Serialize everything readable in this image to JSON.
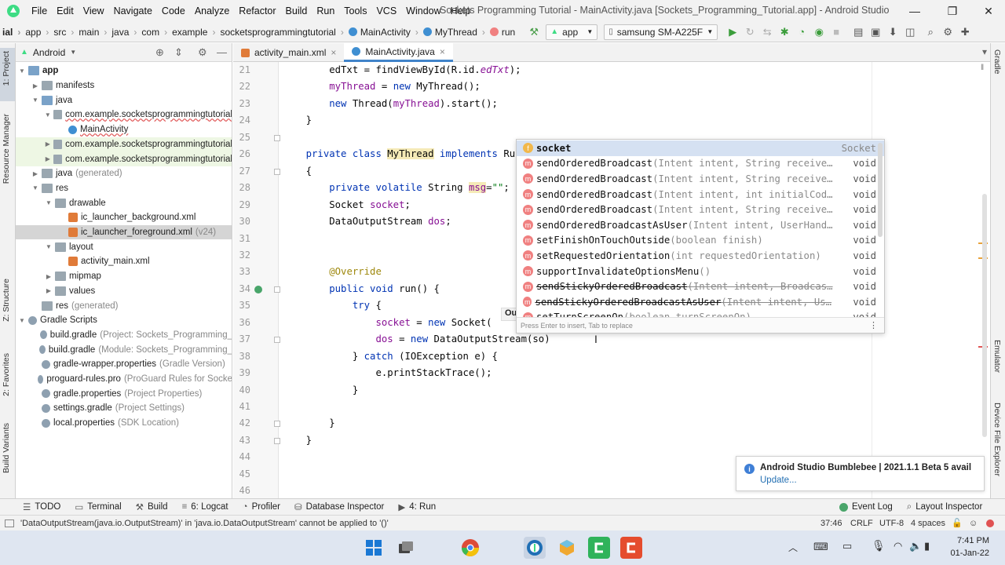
{
  "menubar": {
    "items": [
      "File",
      "Edit",
      "View",
      "Navigate",
      "Code",
      "Analyze",
      "Refactor",
      "Build",
      "Run",
      "Tools",
      "VCS",
      "Window",
      "Help"
    ],
    "title": "Sockets Programming Tutorial - MainActivity.java [Sockets_Programming_Tutorial.app] - Android Studio"
  },
  "breadcrumb": [
    "ial",
    "app",
    "src",
    "main",
    "java",
    "com",
    "example",
    "socketsprogrammingtutorial",
    "MainActivity",
    "MyThread",
    "run"
  ],
  "toolbar": {
    "run_config": "app",
    "device": "samsung SM-A225F"
  },
  "left_strip": {
    "project": "1: Project",
    "resource_manager": "Resource Manager",
    "structure": "Z: Structure",
    "favorites": "2: Favorites",
    "build_variants": "Build Variants"
  },
  "project_panel": {
    "view_mode": "Android",
    "tree": [
      {
        "label": "app",
        "extra": "",
        "depth": 0,
        "arrow": "down",
        "icon": "folder-blue",
        "bold": true
      },
      {
        "label": "manifests",
        "extra": "",
        "depth": 1,
        "arrow": "right",
        "icon": "folder"
      },
      {
        "label": "java",
        "extra": "",
        "depth": 1,
        "arrow": "down",
        "icon": "folder-blue"
      },
      {
        "label": "com.example.socketsprogrammingtutorial",
        "extra": "",
        "depth": 2,
        "arrow": "down",
        "icon": "folder",
        "squiggle": true
      },
      {
        "label": "MainActivity",
        "extra": "",
        "depth": 3,
        "arrow": "",
        "icon": "class",
        "squiggle": true
      },
      {
        "label": "com.example.socketsprogrammingtutorial",
        "extra": "",
        "depth": 2,
        "arrow": "right",
        "icon": "folder",
        "hl": "green"
      },
      {
        "label": "com.example.socketsprogrammingtutorial",
        "extra": "",
        "depth": 2,
        "arrow": "right",
        "icon": "folder",
        "hl": "green"
      },
      {
        "label": "java",
        "extra": "(generated)",
        "depth": 1,
        "arrow": "right",
        "icon": "folder"
      },
      {
        "label": "res",
        "extra": "",
        "depth": 1,
        "arrow": "down",
        "icon": "folder"
      },
      {
        "label": "drawable",
        "extra": "",
        "depth": 2,
        "arrow": "down",
        "icon": "folder"
      },
      {
        "label": "ic_launcher_background.xml",
        "extra": "",
        "depth": 3,
        "arrow": "",
        "icon": "xml"
      },
      {
        "label": "ic_launcher_foreground.xml",
        "extra": "(v24)",
        "depth": 3,
        "arrow": "",
        "icon": "xml",
        "hl": "gray"
      },
      {
        "label": "layout",
        "extra": "",
        "depth": 2,
        "arrow": "down",
        "icon": "folder"
      },
      {
        "label": "activity_main.xml",
        "extra": "",
        "depth": 3,
        "arrow": "",
        "icon": "xml"
      },
      {
        "label": "mipmap",
        "extra": "",
        "depth": 2,
        "arrow": "right",
        "icon": "folder"
      },
      {
        "label": "values",
        "extra": "",
        "depth": 2,
        "arrow": "right",
        "icon": "folder"
      },
      {
        "label": "res",
        "extra": "(generated)",
        "depth": 1,
        "arrow": "",
        "icon": "folder"
      },
      {
        "label": "Gradle Scripts",
        "extra": "",
        "depth": 0,
        "arrow": "down",
        "icon": "gradle"
      },
      {
        "label": "build.gradle",
        "extra": "(Project: Sockets_Programming_",
        "depth": 1,
        "arrow": "",
        "icon": "gradle"
      },
      {
        "label": "build.gradle",
        "extra": "(Module: Sockets_Programming_",
        "depth": 1,
        "arrow": "",
        "icon": "gradle"
      },
      {
        "label": "gradle-wrapper.properties",
        "extra": "(Gradle Version)",
        "depth": 1,
        "arrow": "",
        "icon": "gradle"
      },
      {
        "label": "proguard-rules.pro",
        "extra": "(ProGuard Rules for Socke",
        "depth": 1,
        "arrow": "",
        "icon": "gradle"
      },
      {
        "label": "gradle.properties",
        "extra": "(Project Properties)",
        "depth": 1,
        "arrow": "",
        "icon": "gradle"
      },
      {
        "label": "settings.gradle",
        "extra": "(Project Settings)",
        "depth": 1,
        "arrow": "",
        "icon": "gradle"
      },
      {
        "label": "local.properties",
        "extra": "(SDK Location)",
        "depth": 1,
        "arrow": "",
        "icon": "gradle"
      }
    ]
  },
  "editor": {
    "tabs": [
      {
        "label": "activity_main.xml",
        "active": false
      },
      {
        "label": "MainActivity.java",
        "active": true
      }
    ],
    "line_numbers": [
      "21",
      "22",
      "23",
      "24",
      "25",
      "26",
      "27",
      "28",
      "29",
      "30",
      "31",
      "32",
      "33",
      "34",
      "35",
      "36",
      "37",
      "38",
      "39",
      "40",
      "41",
      "42",
      "43",
      "44",
      "45",
      "46"
    ],
    "lines": [
      [
        {
          "t": "        edTxt = findViewById(R.id.",
          "c": ""
        },
        {
          "t": "edTxt",
          "c": "it"
        },
        {
          "t": ");",
          "c": ""
        }
      ],
      [
        {
          "t": "        ",
          "c": ""
        },
        {
          "t": "myThread",
          "c": "fld"
        },
        {
          "t": " = ",
          "c": ""
        },
        {
          "t": "new",
          "c": "kw"
        },
        {
          "t": " MyThread();",
          "c": ""
        }
      ],
      [
        {
          "t": "        ",
          "c": ""
        },
        {
          "t": "new",
          "c": "kw"
        },
        {
          "t": " Thread(",
          "c": ""
        },
        {
          "t": "myThread",
          "c": "fld"
        },
        {
          "t": ").start();",
          "c": ""
        }
      ],
      [
        {
          "t": "    }",
          "c": ""
        }
      ],
      [
        {
          "t": "",
          "c": ""
        }
      ],
      [
        {
          "t": "    ",
          "c": ""
        },
        {
          "t": "private class",
          "c": "kw"
        },
        {
          "t": " ",
          "c": ""
        },
        {
          "t": "MyThread",
          "c": "hl"
        },
        {
          "t": " ",
          "c": ""
        },
        {
          "t": "implements",
          "c": "kw"
        },
        {
          "t": " Ru",
          "c": ""
        }
      ],
      [
        {
          "t": "    {",
          "c": ""
        }
      ],
      [
        {
          "t": "        ",
          "c": ""
        },
        {
          "t": "private volatile",
          "c": "kw"
        },
        {
          "t": " String ",
          "c": ""
        },
        {
          "t": "msg",
          "c": "fld hl"
        },
        {
          "t": "=",
          "c": ""
        },
        {
          "t": "\"\"",
          "c": "str"
        },
        {
          "t": ";",
          "c": ""
        }
      ],
      [
        {
          "t": "        Socket ",
          "c": ""
        },
        {
          "t": "socket",
          "c": "fld"
        },
        {
          "t": ";",
          "c": ""
        }
      ],
      [
        {
          "t": "        DataOutputStream ",
          "c": ""
        },
        {
          "t": "dos",
          "c": "fld"
        },
        {
          "t": ";",
          "c": ""
        }
      ],
      [
        {
          "t": "",
          "c": ""
        }
      ],
      [
        {
          "t": "",
          "c": ""
        }
      ],
      [
        {
          "t": "        ",
          "c": ""
        },
        {
          "t": "@Override",
          "c": "ann"
        }
      ],
      [
        {
          "t": "        ",
          "c": ""
        },
        {
          "t": "public void",
          "c": "kw"
        },
        {
          "t": " run() {",
          "c": ""
        }
      ],
      [
        {
          "t": "            ",
          "c": ""
        },
        {
          "t": "try",
          "c": "kw"
        },
        {
          "t": " {",
          "c": ""
        }
      ],
      [
        {
          "t": "                ",
          "c": ""
        },
        {
          "t": "socket",
          "c": "fld"
        },
        {
          "t": " = ",
          "c": ""
        },
        {
          "t": "new",
          "c": "kw"
        },
        {
          "t": " Socket(",
          "c": ""
        }
      ],
      [
        {
          "t": "                ",
          "c": ""
        },
        {
          "t": "dos",
          "c": "fld"
        },
        {
          "t": " = ",
          "c": ""
        },
        {
          "t": "new",
          "c": "kw"
        },
        {
          "t": " DataOutputStream(so)",
          "c": ""
        }
      ],
      [
        {
          "t": "            } ",
          "c": ""
        },
        {
          "t": "catch",
          "c": "kw"
        },
        {
          "t": " (IOException e) {",
          "c": ""
        }
      ],
      [
        {
          "t": "                e.printStackTrace();",
          "c": ""
        }
      ],
      [
        {
          "t": "            }",
          "c": ""
        }
      ],
      [
        {
          "t": "",
          "c": ""
        }
      ],
      [
        {
          "t": "        }",
          "c": ""
        }
      ],
      [
        {
          "t": "    }",
          "c": ""
        }
      ],
      [
        {
          "t": "",
          "c": ""
        }
      ],
      [
        {
          "t": "",
          "c": ""
        }
      ],
      [
        {
          "t": "",
          "c": ""
        }
      ]
    ],
    "param_hint": "Ou"
  },
  "completion": {
    "items": [
      {
        "badge": "f",
        "name": "socket",
        "params": "",
        "ret": "Socket",
        "selected": true,
        "strike": false
      },
      {
        "badge": "m",
        "name": "sendOrderedBroadcast",
        "params": "(Intent intent, String receive…",
        "ret": "void",
        "strike": false
      },
      {
        "badge": "m",
        "name": "sendOrderedBroadcast",
        "params": "(Intent intent, String receive…",
        "ret": "void",
        "strike": false
      },
      {
        "badge": "m",
        "name": "sendOrderedBroadcast",
        "params": "(Intent intent, int initialCod…",
        "ret": "void",
        "strike": false
      },
      {
        "badge": "m",
        "name": "sendOrderedBroadcast",
        "params": "(Intent intent, String receive…",
        "ret": "void",
        "strike": false
      },
      {
        "badge": "m",
        "name": "sendOrderedBroadcastAsUser",
        "params": "(Intent intent, UserHand…",
        "ret": "void",
        "strike": false
      },
      {
        "badge": "m",
        "name": "setFinishOnTouchOutside",
        "params": "(boolean finish)",
        "ret": "void",
        "strike": false
      },
      {
        "badge": "m",
        "name": "setRequestedOrientation",
        "params": "(int requestedOrientation)",
        "ret": "void",
        "strike": false
      },
      {
        "badge": "m",
        "name": "supportInvalidateOptionsMenu",
        "params": "()",
        "ret": "void",
        "strike": false
      },
      {
        "badge": "m",
        "name": "sendStickyOrderedBroadcast",
        "params": "(Intent intent, Broadcas…",
        "ret": "void",
        "strike": true
      },
      {
        "badge": "m",
        "name": "sendStickyOrderedBroadcastAsUser",
        "params": "(Intent intent, Us…",
        "ret": "void",
        "strike": true
      },
      {
        "badge": "m",
        "name": "setTurnScreenOn",
        "params": "(boolean turnScreenOn)",
        "ret": "void",
        "strike": false
      }
    ],
    "footer": "Press Enter to insert, Tab to replace"
  },
  "right_strip": {
    "gradle": "Gradle",
    "emulator": "Emulator",
    "device_file_explorer": "Device File Explorer"
  },
  "bottom_tools": [
    {
      "label": "TODO",
      "icon": "list-icon"
    },
    {
      "label": "Terminal",
      "icon": "terminal-icon"
    },
    {
      "label": "Build",
      "icon": "hammer-icon"
    },
    {
      "label": "6: Logcat",
      "icon": "logcat-icon"
    },
    {
      "label": "Profiler",
      "icon": "profiler-icon"
    },
    {
      "label": "Database Inspector",
      "icon": "database-icon"
    },
    {
      "label": "4: Run",
      "icon": "run-icon"
    }
  ],
  "bottom_tools_right": [
    {
      "label": "Event Log"
    },
    {
      "label": "Layout Inspector"
    }
  ],
  "status": {
    "message": "'DataOutputStream(java.io.OutputStream)' in 'java.io.DataOutputStream' cannot be applied to '()'",
    "position": "37:46",
    "line_sep": "CRLF",
    "encoding": "UTF-8",
    "indent": "4 spaces"
  },
  "notification": {
    "title": "Android Studio Bumblebee | 2021.1.1 Beta 5 avail",
    "link": "Update..."
  },
  "taskbar": {
    "time": "7:41 PM",
    "date": "01-Jan-22"
  },
  "colors": {
    "accent": "#4083c9",
    "keyword": "#0033b3",
    "field": "#871094",
    "string": "#067d17",
    "annotation": "#9e880d"
  }
}
